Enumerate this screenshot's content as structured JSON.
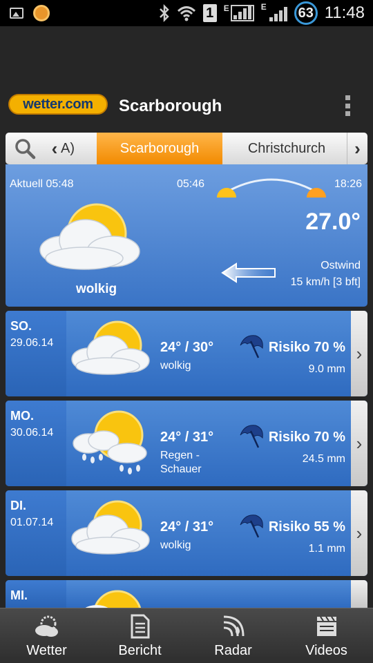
{
  "statusbar": {
    "sim": "1",
    "net1": "E",
    "net2": "E",
    "battery": "63",
    "time": "11:48"
  },
  "header": {
    "logo": "wetter.com",
    "title": "Scarborough"
  },
  "tabs": {
    "partial": "A)",
    "active": "Scarborough",
    "next": "Christchurch"
  },
  "current": {
    "now": "Aktuell 05:48",
    "sunrise": "05:46",
    "sunset": "18:26",
    "temperature": "27.0°",
    "wind_direction": "Ostwind",
    "wind_speed": "15 km/h [3 bft]",
    "condition": "wolkig",
    "icon": "cloudy-sun-icon"
  },
  "forecast": [
    {
      "day": "SO.",
      "date": "29.06.14",
      "temp": "24° / 30°",
      "desc": "wolkig",
      "desc2": "",
      "risk": "Risiko 70 %",
      "rain": "9.0 mm",
      "icon": "cloudy-sun-icon"
    },
    {
      "day": "MO.",
      "date": "30.06.14",
      "temp": "24° / 31°",
      "desc": "Regen -",
      "desc2": "Schauer",
      "risk": "Risiko 70 %",
      "rain": "24.5 mm",
      "icon": "rain-showers-icon"
    },
    {
      "day": "DI.",
      "date": "01.07.14",
      "temp": "24° / 31°",
      "desc": "wolkig",
      "desc2": "",
      "risk": "Risiko 55 %",
      "rain": "1.1 mm",
      "icon": "cloudy-sun-icon"
    },
    {
      "day": "MI.",
      "date": "",
      "temp": "",
      "desc": "",
      "desc2": "",
      "risk": "",
      "rain": "",
      "icon": "cloudy-sun-icon"
    }
  ],
  "nav": [
    {
      "label": "Wetter",
      "icon": "weather-icon"
    },
    {
      "label": "Bericht",
      "icon": "report-icon"
    },
    {
      "label": "Radar",
      "icon": "radar-icon"
    },
    {
      "label": "Videos",
      "icon": "video-clapper-icon"
    }
  ],
  "colors": {
    "accent": "#f28a00",
    "panel": "#3a74c6",
    "logo": "#f4b000"
  }
}
